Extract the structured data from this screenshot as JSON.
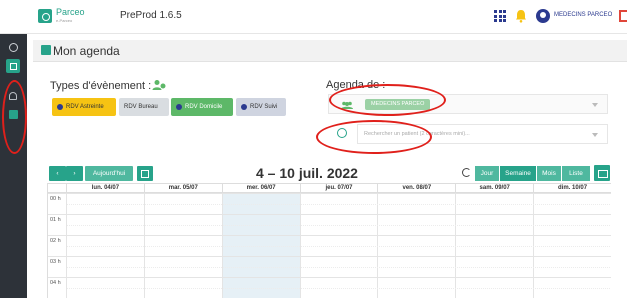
{
  "topbar": {
    "logo_name": "Parceo",
    "logo_sub": "e-Parceo",
    "app_version": "PreProd 1.6.5",
    "user_name": "MEDECINS PARCEO",
    "icons": [
      "grid-icon",
      "bell-icon",
      "user-icon",
      "logout-icon"
    ],
    "accent_color": "#27a38a"
  },
  "sidebar": {
    "items": [
      {
        "icon": "user-circle-icon"
      },
      {
        "icon": "dashboard-icon",
        "active": true
      },
      {
        "icon": "bell-icon"
      },
      {
        "icon": "calendar-icon"
      }
    ]
  },
  "page": {
    "title": "Mon agenda"
  },
  "event_types": {
    "title": "Types d'évènement :",
    "items": [
      {
        "label": "RDV Astreinte",
        "color": "#f6c313"
      },
      {
        "label": "RDV Bureau",
        "color": "#d9dde1"
      },
      {
        "label": "RDV Domicile",
        "color": "#5db868"
      },
      {
        "label": "RDV Suivi",
        "color": "#cfd4e0"
      }
    ]
  },
  "agenda_de": {
    "title": "Agenda de :",
    "selected_chip": "MEDECINS PARCEO",
    "patient_placeholder": "Rechercher un patient (2 caractères mini)..."
  },
  "calendar": {
    "prev": "‹",
    "next": "›",
    "today": "Aujourd'hui",
    "range": "4 – 10 juil. 2022",
    "views": [
      "Jour",
      "Semaine",
      "Mois",
      "Liste"
    ],
    "active_view": "Semaine",
    "days": [
      "lun. 04/07",
      "mar. 05/07",
      "mer. 06/07",
      "jeu. 07/07",
      "ven. 08/07",
      "sam. 09/07",
      "dim. 10/07"
    ],
    "today_index": 2,
    "hours": [
      "00 h",
      "01 h",
      "02 h",
      "03 h",
      "04 h"
    ]
  }
}
